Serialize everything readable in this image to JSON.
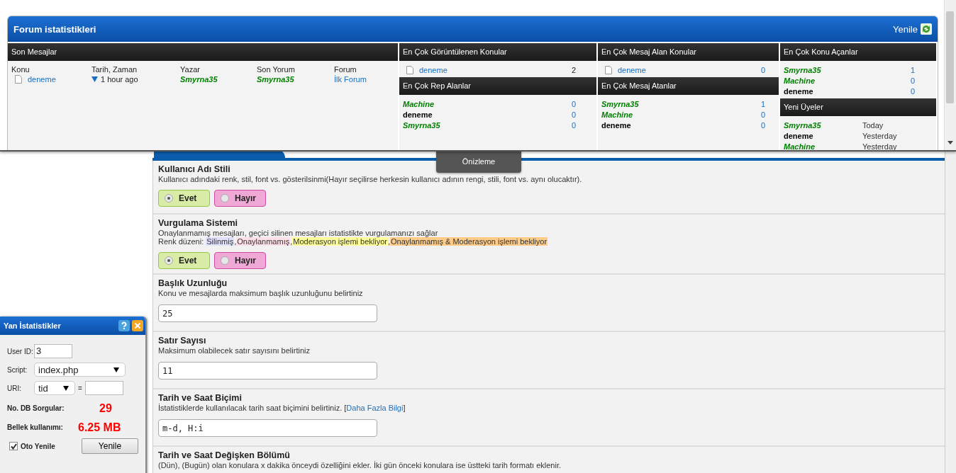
{
  "popup": {
    "title": "Forum istatistikleri",
    "refresh": "Yenile",
    "recent": {
      "heading": "Son Mesajlar",
      "columns": [
        "Konu",
        "Tarih, Zaman",
        "Yazar",
        "Son Yorum",
        "Forum"
      ],
      "rows": [
        {
          "topic": "deneme",
          "time": "1 hour ago",
          "author": {
            "name": "Smyrna35",
            "color": "#008000",
            "italic": true
          },
          "last": {
            "name": "Smyrna35",
            "color": "#008000",
            "italic": true
          },
          "forum": "İlk Forum"
        }
      ]
    },
    "most_viewed": {
      "heading": "En Çok Görüntülenen Konular",
      "rows": [
        {
          "topic": "deneme",
          "count": "2"
        }
      ]
    },
    "top_rep": {
      "heading": "En Çok Rep Alanlar",
      "rows": [
        {
          "user": {
            "name": "Machine",
            "color": "#008000",
            "italic": true
          },
          "count": "0"
        },
        {
          "user": {
            "name": "deneme",
            "color": "#000000",
            "italic": false
          },
          "count": "0"
        },
        {
          "user": {
            "name": "Smyrna35",
            "color": "#008000",
            "italic": true
          },
          "count": "0"
        }
      ]
    },
    "most_replied": {
      "heading": "En Çok Mesaj Alan Konular",
      "rows": [
        {
          "topic": "deneme",
          "count": "0"
        }
      ]
    },
    "top_posters": {
      "heading": "En Çok Mesaj Atanlar",
      "rows": [
        {
          "user": {
            "name": "Smyrna35",
            "color": "#008000",
            "italic": true
          },
          "count": "1"
        },
        {
          "user": {
            "name": "Machine",
            "color": "#008000",
            "italic": true
          },
          "count": "0"
        },
        {
          "user": {
            "name": "deneme",
            "color": "#000000",
            "italic": false
          },
          "count": "0"
        }
      ]
    },
    "top_starters": {
      "heading": "En Çok Konu Açanlar",
      "rows": [
        {
          "user": {
            "name": "Smyrna35",
            "color": "#008000",
            "italic": true
          },
          "count": "1"
        },
        {
          "user": {
            "name": "Machine",
            "color": "#008000",
            "italic": true
          },
          "count": "0"
        },
        {
          "user": {
            "name": "deneme",
            "color": "#000000",
            "italic": false
          },
          "count": "0"
        }
      ]
    },
    "new_members": {
      "heading": "Yeni Üyeler",
      "rows": [
        {
          "user": {
            "name": "Smyrna35",
            "color": "#008000",
            "italic": true
          },
          "when": "Today"
        },
        {
          "user": {
            "name": "deneme",
            "color": "#000000",
            "italic": false
          },
          "when": "Yesterday"
        },
        {
          "user": {
            "name": "Machine",
            "color": "#008000",
            "italic": true
          },
          "when": "Yesterday"
        }
      ]
    }
  },
  "preview_button": "Önizleme",
  "settings": {
    "rows": [
      {
        "kind": "radio",
        "title": "Kullanıcı Adı Stili",
        "description": "Kullanıcı adındaki renk, stil, font vs. gösterilsinmi(Hayır seçilirse herkesin kullanıcı adının rengi, stili, font vs. aynı olucaktır).",
        "options": [
          {
            "label": "Evet",
            "selected": true
          },
          {
            "label": "Hayır",
            "selected": false
          }
        ]
      },
      {
        "kind": "radio",
        "title": "Vurgulama Sistemi",
        "description": "Onaylanmamış mesajları, geçici silinen mesajları istatistikte vurgulamanızı sağlar",
        "legend": {
          "label": "Renk düzeni:",
          "items": [
            {
              "text": "Silinmiş",
              "color": "#e0e0ff",
              "after": ","
            },
            {
              "text": "Onaylanmamış",
              "color": "#ffe0e8",
              "after": ","
            },
            {
              "text": "Moderasyon işlemi bekliyor",
              "color": "#ffff99",
              "after": ","
            },
            {
              "text": "Onaylanmamış & Moderasyon işlemi bekliyor",
              "color": "#ffcc88"
            }
          ]
        },
        "options": [
          {
            "label": "Evet",
            "selected": true
          },
          {
            "label": "Hayır",
            "selected": false
          }
        ]
      },
      {
        "kind": "text",
        "title": "Başlık Uzunluğu",
        "description": "Konu ve mesajlarda maksimum başlık uzunluğunu belirtiniz",
        "value": "25"
      },
      {
        "kind": "text",
        "title": "Satır Sayısı",
        "description": "Maksimum olabilecek satır sayısını belirtiniz",
        "value": "11"
      },
      {
        "kind": "text",
        "title": "Tarih ve Saat Biçimi",
        "description": "İstatistiklerde kullanılacak tarih saat biçimini belirtiniz. [",
        "link": "Daha Fazla Bilgi",
        "after_link": "]",
        "value": "m-d, H:i"
      },
      {
        "kind": "text",
        "title": "Tarih ve Saat Değişken Bölümü",
        "description": "(Dün), (Bugün) olan konulara x dakika önceydi özelliğini ekler. İki gün önceki konulara ise üstteki tarih formatı eklenir."
      }
    ]
  },
  "side_panel": {
    "title": "Yan İstatistikler",
    "user_id": {
      "label": "User ID:",
      "value": "3"
    },
    "script": {
      "label": "Script:",
      "value": "index.php"
    },
    "uri": {
      "label": "URI:",
      "value": "tid",
      "equals": "="
    },
    "queries": {
      "label": "No. DB Sorgular:",
      "value": "29"
    },
    "memory": {
      "label": "Bellek kullanımı:",
      "value": "6.25 MB"
    },
    "auto_refresh": {
      "label": "Oto Yenile",
      "checked": true
    },
    "refresh": "Yenile"
  }
}
